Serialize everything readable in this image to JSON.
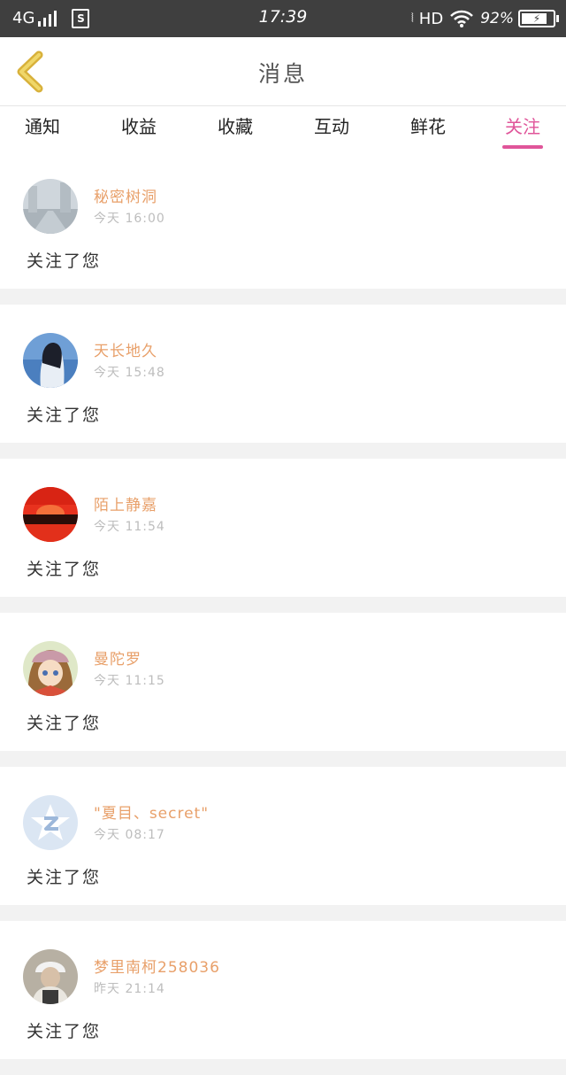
{
  "status_bar": {
    "network": "4G",
    "sim_icon": "S",
    "time": "17:39",
    "hd": "HD",
    "battery_percent": "92%",
    "battery_level": 0.92
  },
  "header": {
    "title": "消息",
    "back_icon": "chevron-left-icon"
  },
  "tabs": [
    {
      "label": "通知",
      "active": false
    },
    {
      "label": "收益",
      "active": false
    },
    {
      "label": "收藏",
      "active": false
    },
    {
      "label": "互动",
      "active": false
    },
    {
      "label": "鲜花",
      "active": false
    },
    {
      "label": "关注",
      "active": true
    }
  ],
  "colors": {
    "accent": "#e0559a",
    "name": "#e8a06a",
    "status_bar": "#3f3f3f"
  },
  "messages": [
    {
      "name": "秘密树洞",
      "time": "今天 16:00",
      "action": "关注了您"
    },
    {
      "name": "天长地久",
      "time": "今天 15:48",
      "action": "关注了您"
    },
    {
      "name": "陌上静嘉",
      "time": "今天 11:54",
      "action": "关注了您"
    },
    {
      "name": "曼陀罗",
      "time": "今天 11:15",
      "action": "关注了您"
    },
    {
      "name": "\"夏目、secret\"",
      "time": "今天 08:17",
      "action": "关注了您"
    },
    {
      "name": "梦里南柯258036",
      "time": "昨天 21:14",
      "action": "关注了您"
    }
  ]
}
